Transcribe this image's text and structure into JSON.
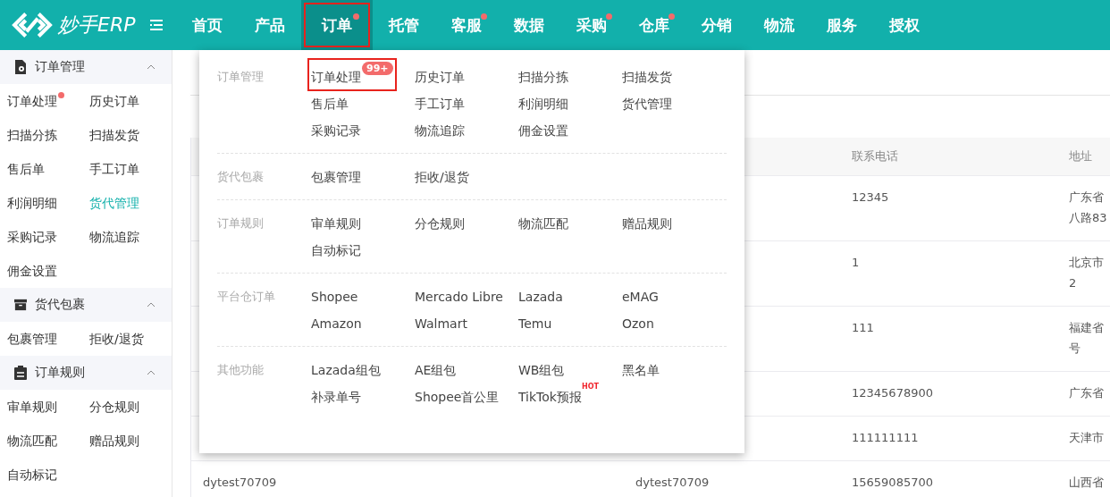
{
  "brand": {
    "name": "妙手ERP"
  },
  "nav": [
    {
      "label": "首页",
      "selected": false,
      "dot": false,
      "highlighted": false
    },
    {
      "label": "产品",
      "selected": false,
      "dot": false,
      "highlighted": false
    },
    {
      "label": "订单",
      "selected": true,
      "dot": true,
      "highlighted": true
    },
    {
      "label": "托管",
      "selected": false,
      "dot": false,
      "highlighted": false
    },
    {
      "label": "客服",
      "selected": false,
      "dot": true,
      "highlighted": false
    },
    {
      "label": "数据",
      "selected": false,
      "dot": false,
      "highlighted": false
    },
    {
      "label": "采购",
      "selected": false,
      "dot": true,
      "highlighted": false
    },
    {
      "label": "仓库",
      "selected": false,
      "dot": true,
      "highlighted": false
    },
    {
      "label": "分销",
      "selected": false,
      "dot": false,
      "highlighted": false
    },
    {
      "label": "物流",
      "selected": false,
      "dot": false,
      "highlighted": false
    },
    {
      "label": "服务",
      "selected": false,
      "dot": false,
      "highlighted": false
    },
    {
      "label": "授权",
      "selected": false,
      "dot": false,
      "highlighted": false
    }
  ],
  "sidebar": {
    "groups": [
      {
        "title": "订单管理",
        "kind": "document",
        "expanded": true,
        "items": [
          {
            "label": "订单处理",
            "selected": false,
            "dot": true
          },
          {
            "label": "历史订单",
            "selected": false,
            "dot": false
          },
          {
            "label": "扫描分拣",
            "selected": false,
            "dot": false
          },
          {
            "label": "扫描发货",
            "selected": false,
            "dot": false
          },
          {
            "label": "售后单",
            "selected": false,
            "dot": false
          },
          {
            "label": "手工订单",
            "selected": false,
            "dot": false
          },
          {
            "label": "利润明细",
            "selected": false,
            "dot": false
          },
          {
            "label": "货代管理",
            "selected": true,
            "dot": false
          },
          {
            "label": "采购记录",
            "selected": false,
            "dot": false
          },
          {
            "label": "物流追踪",
            "selected": false,
            "dot": false
          },
          {
            "label": "佣金设置",
            "selected": false,
            "dot": false
          }
        ]
      },
      {
        "title": "货代包裹",
        "kind": "box",
        "expanded": true,
        "items": [
          {
            "label": "包裹管理",
            "selected": false,
            "dot": false
          },
          {
            "label": "拒收/退货",
            "selected": false,
            "dot": false
          }
        ]
      },
      {
        "title": "订单规则",
        "kind": "clipboard",
        "expanded": true,
        "items": [
          {
            "label": "审单规则",
            "selected": false,
            "dot": false
          },
          {
            "label": "分仓规则",
            "selected": false,
            "dot": false
          },
          {
            "label": "物流匹配",
            "selected": false,
            "dot": false
          },
          {
            "label": "赠品规则",
            "selected": false,
            "dot": false
          },
          {
            "label": "自动标记",
            "selected": false,
            "dot": false
          }
        ]
      }
    ]
  },
  "dropdown": {
    "sections": [
      {
        "title": "订单管理",
        "items": [
          {
            "label": "订单处理",
            "badge": "99+",
            "highlighted": true
          },
          {
            "label": "历史订单"
          },
          {
            "label": "扫描分拣"
          },
          {
            "label": "扫描发货"
          },
          {
            "label": "售后单"
          },
          {
            "label": "手工订单"
          },
          {
            "label": "利润明细"
          },
          {
            "label": "货代管理"
          },
          {
            "label": "采购记录"
          },
          {
            "label": "物流追踪"
          },
          {
            "label": "佣金设置"
          }
        ]
      },
      {
        "title": "货代包裹",
        "items": [
          {
            "label": "包裹管理"
          },
          {
            "label": "拒收/退货"
          }
        ]
      },
      {
        "title": "订单规则",
        "items": [
          {
            "label": "审单规则"
          },
          {
            "label": "分仓规则"
          },
          {
            "label": "物流匹配"
          },
          {
            "label": "赠品规则"
          },
          {
            "label": "自动标记"
          }
        ]
      },
      {
        "title": "平台仓订单",
        "items": [
          {
            "label": "Shopee"
          },
          {
            "label": "Mercado Libre"
          },
          {
            "label": "Lazada"
          },
          {
            "label": "eMAG"
          },
          {
            "label": "Amazon"
          },
          {
            "label": "Walmart"
          },
          {
            "label": "Temu"
          },
          {
            "label": "Ozon"
          }
        ]
      },
      {
        "title": "其他功能",
        "items": [
          {
            "label": "Lazada组包"
          },
          {
            "label": "AE组包"
          },
          {
            "label": "WB组包"
          },
          {
            "label": "黑名单"
          },
          {
            "label": "补录单号"
          },
          {
            "label": "Shopee首公里"
          },
          {
            "label": "TikTok预报",
            "tag": "HOT"
          }
        ]
      }
    ]
  },
  "table": {
    "columns": [
      "联系电话",
      "地址"
    ],
    "rows": [
      {
        "phone": "12345",
        "address": [
          "广东省",
          "八路83"
        ]
      },
      {
        "phone": "1",
        "address": [
          "北京市",
          "2"
        ]
      },
      {
        "phone": "111",
        "address": [
          "福建省",
          "号"
        ]
      },
      {
        "phone": "12345678900",
        "address": [
          "广东省"
        ]
      },
      {
        "phone": "111111111",
        "address": [
          "天津市"
        ]
      },
      {
        "column_1": "dytest70709",
        "column_2": "dytest70709",
        "phone": "15659085700",
        "address": [
          "山西省"
        ]
      }
    ]
  }
}
